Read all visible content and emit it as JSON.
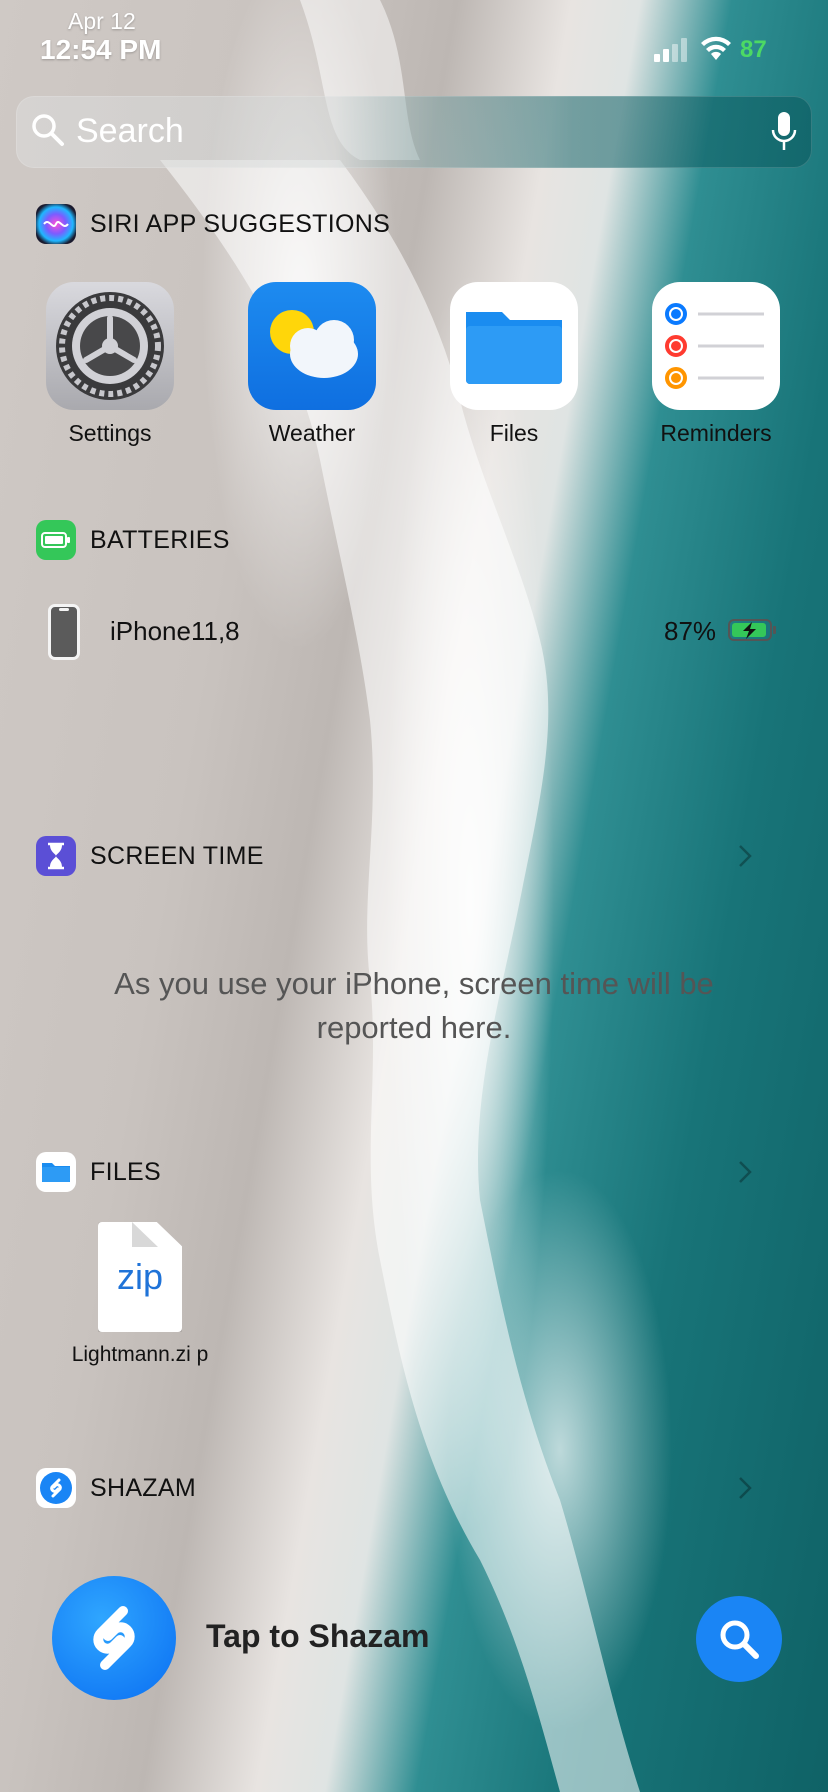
{
  "status_bar": {
    "date": "Apr 12",
    "time": "12:54 PM",
    "battery": "87"
  },
  "search": {
    "placeholder": "Search"
  },
  "siri_suggestions": {
    "title": "SIRI APP SUGGESTIONS",
    "apps": [
      {
        "label": "Settings",
        "icon": "settings-gear-icon"
      },
      {
        "label": "Weather",
        "icon": "weather-sun-cloud-icon"
      },
      {
        "label": "Files",
        "icon": "files-folder-icon"
      },
      {
        "label": "Reminders",
        "icon": "reminders-list-icon"
      }
    ]
  },
  "batteries": {
    "title": "BATTERIES",
    "device_name": "iPhone11,8",
    "percent": "87%",
    "charging": true
  },
  "screen_time": {
    "title": "SCREEN TIME",
    "message": "As you use your iPhone, screen time will be reported here."
  },
  "files": {
    "title": "FILES",
    "items": [
      {
        "name": "Lightmann.zi p",
        "type_label": "zip"
      }
    ]
  },
  "shazam": {
    "title": "SHAZAM",
    "action_label": "Tap to Shazam"
  },
  "colors": {
    "accent_blue": "#1a85f5",
    "battery_green": "#4cd964",
    "screen_time_purple": "#5b4fd6"
  }
}
